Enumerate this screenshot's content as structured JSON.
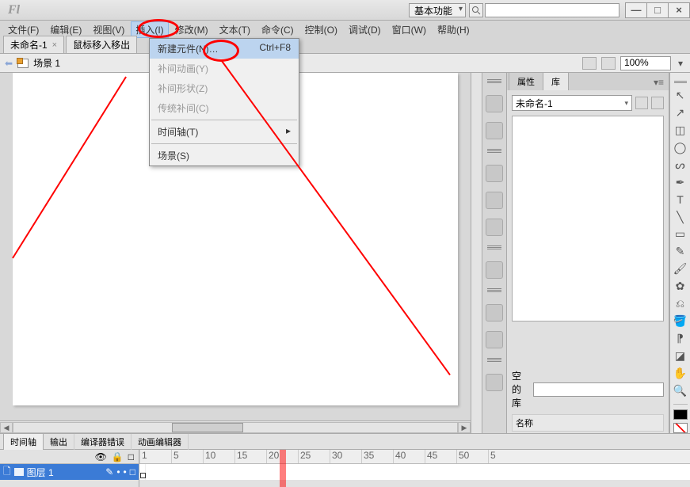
{
  "app": {
    "logo": "Fl",
    "workspace": "基本功能"
  },
  "window_buttons": {
    "min": "—",
    "max": "□",
    "close": "×"
  },
  "menu": [
    "文件(F)",
    "编辑(E)",
    "视图(V)",
    "插入(I)",
    "修改(M)",
    "文本(T)",
    "命令(C)",
    "控制(O)",
    "调试(D)",
    "窗口(W)",
    "帮助(H)"
  ],
  "menu_active_index": 3,
  "dropdown": {
    "items": [
      {
        "label": "新建元件(N)…",
        "shortcut": "Ctrl+F8",
        "state": "highlight"
      },
      {
        "label": "补间动画(Y)",
        "state": "disabled"
      },
      {
        "label": "补间形状(Z)",
        "state": "disabled"
      },
      {
        "label": "传统补间(C)",
        "state": "disabled"
      },
      {
        "sep": true
      },
      {
        "label": "时间轴(T)",
        "arrow": true
      },
      {
        "sep": true
      },
      {
        "label": "场景(S)"
      }
    ]
  },
  "file_tabs": [
    "未命名-1",
    "鼠标移入移出"
  ],
  "scene": {
    "label": "场景 1",
    "zoom": "100%"
  },
  "library": {
    "tab_props": "属性",
    "tab_lib": "库",
    "doc": "未命名-1",
    "empty_label": "空的库",
    "name_col": "名称"
  },
  "timeline": {
    "tabs": [
      "时间轴",
      "输出",
      "编译器错误",
      "动画编辑器"
    ],
    "layer": "图层 1",
    "ruler": [
      "1",
      "5",
      "10",
      "15",
      "20",
      "25",
      "30",
      "35",
      "40",
      "45",
      "50",
      "5"
    ]
  }
}
